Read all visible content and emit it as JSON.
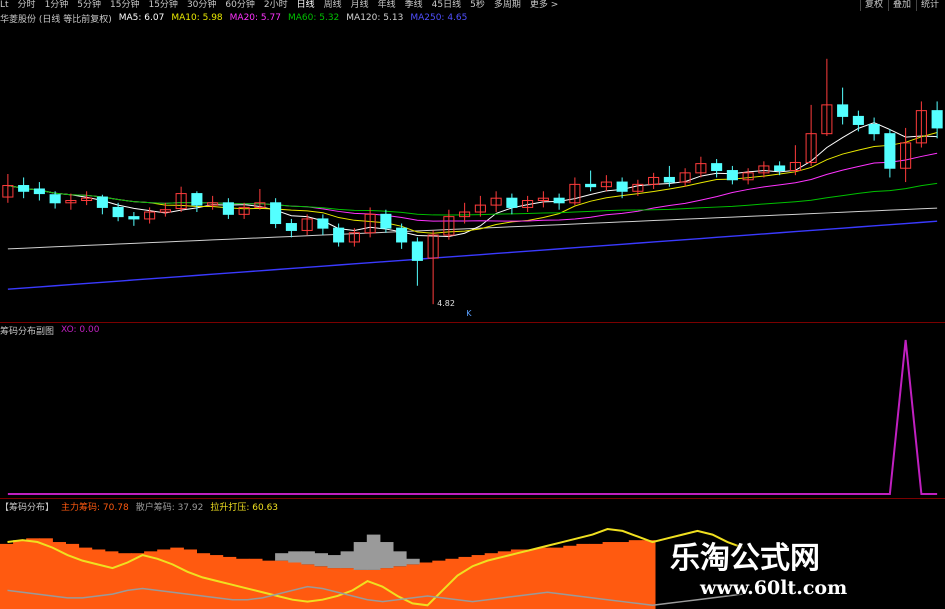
{
  "toolbar": {
    "tabs": [
      "Lt",
      "分时",
      "1分钟",
      "5分钟",
      "15分钟",
      "15分钟",
      "30分钟",
      "60分钟",
      "2小时",
      "日线",
      "周线",
      "月线",
      "年线",
      "季线",
      "45日线",
      "5秒",
      "多周期",
      "更多 >"
    ],
    "active_tab": "日线",
    "right_buttons": [
      "复权",
      "叠加",
      "统计"
    ]
  },
  "main_legend": {
    "stock": "华菱股份 (日线 等比前复权)",
    "ma5": "MA5: 6.07",
    "ma10": "MA10: 5.98",
    "ma20": "MA20: 5.77",
    "ma60": "MA60: 5.32",
    "ma120": "MA120: 5.13",
    "ma250": "MA250: 4.65"
  },
  "price_low_label": "4.82",
  "k_marker": "K",
  "pane2_legend": {
    "title": "筹码分布副图",
    "xo": "XO: 0.00"
  },
  "pane3_legend": {
    "title": "【筹码分布】",
    "main_chip": "主力筹码: 70.78",
    "retail_chip": "散户筹码: 37.92",
    "breakout": "拉升打压: 60.63"
  },
  "watermark": {
    "cn": "乐淘公式网",
    "url": "www.60lt.com"
  },
  "colors": {
    "up": "#ff3c3c",
    "down": "#54ffff",
    "ma5": "#ffffff",
    "ma10": "#e8e800",
    "ma20": "#ff33ff",
    "ma60": "#00c000",
    "ma120": "#d0d0d0",
    "ma250": "#3a3aff",
    "orange": "#ff5a10",
    "gray": "#9a9a9a",
    "yellow": "#f0e020",
    "purple": "#c020c0"
  },
  "chart_data": [
    {
      "type": "candlestick",
      "candles": [
        [
          5.75,
          5.85,
          5.95,
          5.7
        ],
        [
          5.85,
          5.8,
          5.92,
          5.74
        ],
        [
          5.82,
          5.78,
          5.88,
          5.72
        ],
        [
          5.77,
          5.7,
          5.8,
          5.65
        ],
        [
          5.7,
          5.72,
          5.78,
          5.64
        ],
        [
          5.72,
          5.74,
          5.8,
          5.68
        ],
        [
          5.75,
          5.66,
          5.77,
          5.6
        ],
        [
          5.66,
          5.58,
          5.7,
          5.54
        ],
        [
          5.58,
          5.56,
          5.62,
          5.5
        ],
        [
          5.56,
          5.62,
          5.66,
          5.52
        ],
        [
          5.62,
          5.64,
          5.7,
          5.58
        ],
        [
          5.65,
          5.78,
          5.84,
          5.62
        ],
        [
          5.78,
          5.68,
          5.8,
          5.62
        ],
        [
          5.68,
          5.7,
          5.76,
          5.64
        ],
        [
          5.7,
          5.6,
          5.74,
          5.56
        ],
        [
          5.6,
          5.66,
          5.7,
          5.56
        ],
        [
          5.66,
          5.7,
          5.82,
          5.64
        ],
        [
          5.7,
          5.52,
          5.74,
          5.48
        ],
        [
          5.52,
          5.46,
          5.56,
          5.4
        ],
        [
          5.46,
          5.56,
          5.6,
          5.42
        ],
        [
          5.56,
          5.48,
          5.6,
          5.42
        ],
        [
          5.48,
          5.36,
          5.52,
          5.32
        ],
        [
          5.36,
          5.44,
          5.48,
          5.32
        ],
        [
          5.44,
          5.6,
          5.66,
          5.4
        ],
        [
          5.6,
          5.48,
          5.64,
          5.44
        ],
        [
          5.48,
          5.36,
          5.52,
          5.3
        ],
        [
          5.36,
          5.2,
          5.4,
          4.98
        ],
        [
          5.22,
          5.42,
          5.46,
          4.82
        ],
        [
          5.42,
          5.58,
          5.64,
          5.38
        ],
        [
          5.58,
          5.62,
          5.7,
          5.52
        ],
        [
          5.62,
          5.68,
          5.76,
          5.58
        ],
        [
          5.68,
          5.74,
          5.8,
          5.62
        ],
        [
          5.74,
          5.66,
          5.78,
          5.6
        ],
        [
          5.66,
          5.72,
          5.76,
          5.62
        ],
        [
          5.72,
          5.74,
          5.8,
          5.66
        ],
        [
          5.74,
          5.7,
          5.78,
          5.64
        ],
        [
          5.7,
          5.86,
          5.92,
          5.68
        ],
        [
          5.86,
          5.84,
          5.98,
          5.8
        ],
        [
          5.84,
          5.88,
          5.94,
          5.8
        ],
        [
          5.88,
          5.8,
          5.92,
          5.74
        ],
        [
          5.8,
          5.86,
          5.9,
          5.76
        ],
        [
          5.86,
          5.92,
          5.96,
          5.82
        ],
        [
          5.92,
          5.88,
          6.02,
          5.84
        ],
        [
          5.88,
          5.96,
          6.0,
          5.84
        ],
        [
          5.96,
          6.04,
          6.1,
          5.92
        ],
        [
          6.04,
          5.98,
          6.08,
          5.92
        ],
        [
          5.98,
          5.9,
          6.02,
          5.86
        ],
        [
          5.9,
          5.96,
          6.0,
          5.86
        ],
        [
          5.96,
          6.02,
          6.06,
          5.92
        ],
        [
          6.02,
          5.98,
          6.06,
          5.94
        ],
        [
          5.98,
          6.05,
          6.2,
          5.94
        ],
        [
          6.05,
          6.3,
          6.55,
          6.02
        ],
        [
          6.3,
          6.55,
          6.95,
          6.28
        ],
        [
          6.55,
          6.45,
          6.7,
          6.38
        ],
        [
          6.45,
          6.38,
          6.5,
          6.32
        ],
        [
          6.38,
          6.3,
          6.44,
          6.24
        ],
        [
          6.3,
          6.0,
          6.34,
          5.92
        ],
        [
          6.0,
          6.22,
          6.35,
          5.88
        ],
        [
          6.22,
          6.5,
          6.58,
          6.18
        ],
        [
          6.5,
          6.35,
          6.58,
          6.26
        ]
      ],
      "yrange": [
        4.7,
        7.2
      ]
    },
    {
      "type": "line",
      "series": [
        {
          "name": "XO",
          "values": [
            0,
            0,
            0,
            0,
            0,
            0,
            0,
            0,
            0,
            0,
            0,
            0,
            0,
            0,
            0,
            0,
            0,
            0,
            0,
            0,
            0,
            0,
            0,
            0,
            0,
            0,
            0,
            0,
            0,
            0,
            0,
            0,
            0,
            0,
            0,
            0,
            0,
            0,
            0,
            0,
            0,
            0,
            0,
            0,
            0,
            0,
            0,
            0,
            0,
            0,
            0,
            0,
            0,
            0,
            0,
            0,
            0,
            1,
            0,
            0
          ]
        }
      ]
    },
    {
      "type": "area",
      "orange": [
        70,
        74,
        76,
        76,
        72,
        70,
        66,
        64,
        62,
        60,
        60,
        62,
        64,
        66,
        64,
        60,
        58,
        56,
        54,
        54,
        52,
        52,
        50,
        48,
        46,
        44,
        44,
        42,
        42,
        44,
        46,
        48,
        50,
        52,
        54,
        56,
        58,
        60,
        62,
        64,
        64,
        66,
        66,
        68,
        70,
        70,
        72,
        72,
        74,
        74
      ],
      "gray": [
        0,
        0,
        0,
        0,
        0,
        0,
        0,
        0,
        0,
        0,
        0,
        0,
        0,
        0,
        0,
        0,
        0,
        0,
        0,
        0,
        0,
        60,
        62,
        62,
        60,
        58,
        62,
        72,
        80,
        72,
        62,
        54,
        0,
        0,
        0,
        0,
        0,
        0,
        0,
        0,
        0,
        0,
        0,
        0,
        0,
        0,
        0,
        0,
        0,
        0
      ],
      "yellow": [
        72,
        74,
        72,
        66,
        58,
        52,
        48,
        44,
        50,
        58,
        54,
        48,
        40,
        34,
        30,
        26,
        22,
        18,
        14,
        10,
        8,
        10,
        14,
        20,
        30,
        24,
        14,
        6,
        4,
        20,
        36,
        46,
        52,
        56,
        60,
        64,
        68,
        72,
        76,
        80,
        86,
        84,
        78,
        72,
        76,
        80,
        84,
        80,
        72,
        66
      ],
      "gray_line": [
        20,
        18,
        16,
        14,
        12,
        12,
        14,
        16,
        20,
        22,
        20,
        18,
        16,
        14,
        12,
        10,
        10,
        12,
        16,
        20,
        24,
        22,
        18,
        14,
        10,
        8,
        10,
        12,
        14,
        12,
        10,
        8,
        10,
        12,
        14,
        16,
        18,
        16,
        14,
        12,
        10,
        8,
        6,
        4,
        6,
        8,
        10,
        12,
        14,
        16
      ]
    }
  ]
}
